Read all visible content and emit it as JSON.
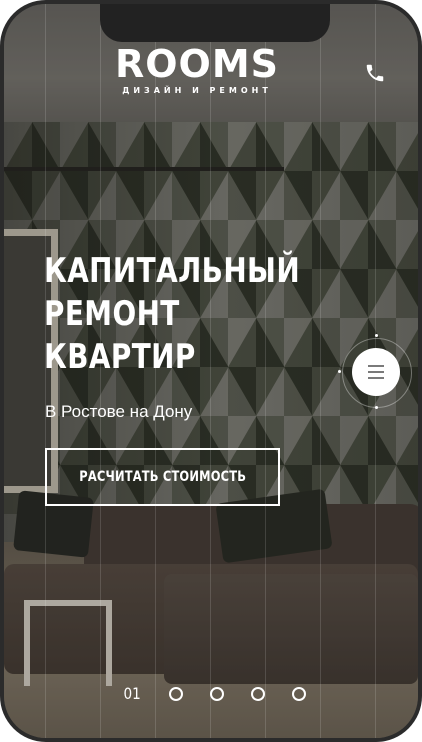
{
  "header": {
    "logo_text": "ROOMS",
    "logo_subtitle": "ДИЗАЙН И РЕМОНТ",
    "phone_icon": "phone-icon"
  },
  "hero": {
    "headline_lines": [
      "КАПИТАЛЬНЫЙ",
      "РЕМОНТ",
      "КВАРТИР"
    ],
    "subtitle": "В Ростове на Дону",
    "cta_label": "РАСЧИТАТЬ СТОИМОСТЬ"
  },
  "menu": {
    "icon": "hamburger-icon"
  },
  "pagination": {
    "current": "01",
    "dots_total": 4
  },
  "colors": {
    "text": "#ffffff",
    "menu_bg": "#ffffff",
    "menu_lines": "#7a7a7a"
  }
}
